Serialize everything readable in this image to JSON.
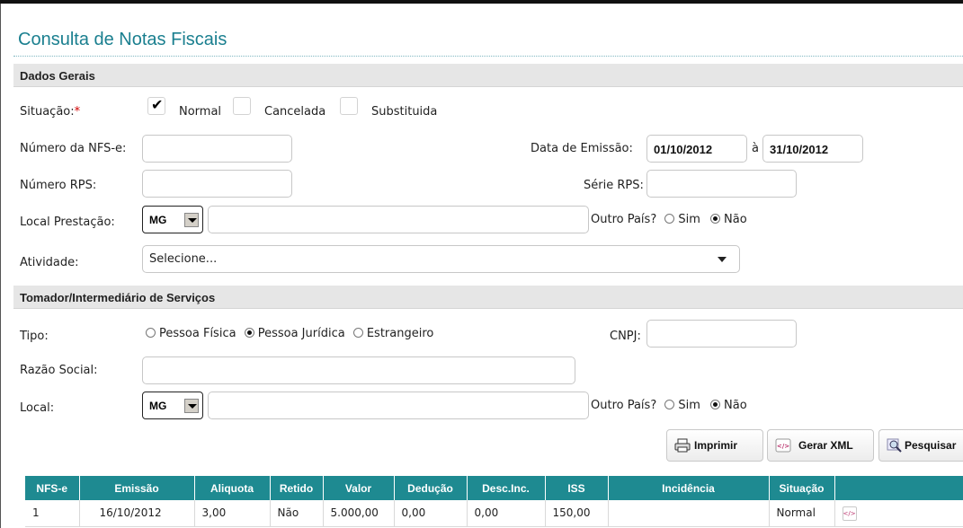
{
  "page": {
    "title": "Consulta de Notas Fiscais"
  },
  "sections": {
    "dados_gerais": "Dados Gerais",
    "tomador": "Tomador/Intermediário de Serviços"
  },
  "situacao": {
    "label": "Situação:",
    "required": "*",
    "options": [
      {
        "label": "Normal",
        "checked": true
      },
      {
        "label": "Cancelada",
        "checked": false
      },
      {
        "label": "Substituida",
        "checked": false
      }
    ]
  },
  "numero_nfse": {
    "label": "Número da NFS-e:",
    "value": ""
  },
  "data_emissao": {
    "label": "Data de Emissão:",
    "from": "01/10/2012",
    "sep": "à",
    "to": "31/10/2012"
  },
  "numero_rps": {
    "label": "Número RPS:",
    "value": ""
  },
  "serie_rps": {
    "label": "Série RPS:",
    "value": ""
  },
  "local_prestacao": {
    "label": "Local Prestação:",
    "uf": "MG",
    "municipio": "",
    "outro_pais": "Outro País?",
    "sim": "Sim",
    "nao": "Não",
    "selected": "Não"
  },
  "atividade": {
    "label": "Atividade:",
    "value": "Selecione..."
  },
  "tomador": {
    "tipo_label": "Tipo:",
    "tipos": [
      "Pessoa Física",
      "Pessoa Jurídica",
      "Estrangeiro"
    ],
    "tipo_selected": "Pessoa Jurídica",
    "cnpj_label": "CNPJ:",
    "cnpj": "",
    "razao_label": "Razão Social:",
    "razao": "",
    "local_label": "Local:",
    "uf": "MG",
    "municipio": "",
    "outro_pais": "Outro País?",
    "sim": "Sim",
    "nao": "Não"
  },
  "buttons": {
    "imprimir": "Imprimir",
    "gerar_xml": "Gerar XML",
    "pesquisar": "Pesquisar"
  },
  "table": {
    "headers": [
      "NFS-e",
      "Emissão",
      "Aliquota",
      "Retido",
      "Valor",
      "Dedução",
      "Desc.Inc.",
      "ISS",
      "Incidência",
      "Situação",
      ""
    ],
    "rows": [
      [
        "1",
        "16/10/2012",
        "3,00",
        "Não",
        "5.000,00",
        "0,00",
        "0,00",
        "150,00",
        "",
        "Normal",
        ""
      ]
    ]
  },
  "colors": {
    "accent": "#1a7f8f",
    "header_bg": "#1e8a91",
    "section_bg": "#e6e6e6",
    "required": "#d00000"
  }
}
